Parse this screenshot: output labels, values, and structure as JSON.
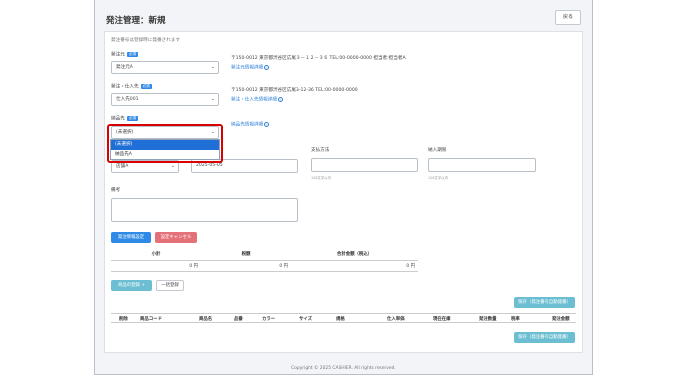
{
  "page": {
    "title": "発注管理：新規",
    "back_label": "戻る",
    "note": "発注番号は登録時に発番されます"
  },
  "order_source": {
    "label": "発注元",
    "required_badge": "必須",
    "value": "発注元A",
    "address": "〒150-0012  東京都渋谷区広尾３－１２－３６  TEL:00-0000-0000  担当者:担当者A",
    "detail_link": "発注元情報詳細"
  },
  "supplier": {
    "label": "発注・仕入先",
    "required_badge": "必須",
    "value": "仕入先001",
    "address": "〒150-0012  東京都渋谷区広尾3-12-36  TEL:00-0000-0000",
    "detail_link": "発注・仕入先情報詳細"
  },
  "delivery": {
    "label": "納品先",
    "required_badge": "必須",
    "value": "(未選択)",
    "detail_link": "納品先情報詳細",
    "options": [
      "(未選択)",
      "納品先A"
    ]
  },
  "row3": {
    "store_value": "店舗A",
    "date_value": "2025-05-05",
    "payment_label": "支払方法",
    "payment_hint": "128文字以内",
    "deadline_label": "納入期限",
    "deadline_hint": "128文字以内"
  },
  "remarks": {
    "label": "備考"
  },
  "buttons": {
    "set_info": "発注情報設定",
    "cancel_setting": "設定キャンセル"
  },
  "summary": {
    "headers": [
      "小計",
      "税額",
      "合計金額（税込）"
    ],
    "values": [
      "0 円",
      "0 円",
      "0 円"
    ]
  },
  "product_buttons": {
    "register": "商品の登録",
    "register_icon": "plus-icon",
    "bulk": "一括登録"
  },
  "save_label": "保存（発注番号自動発番）",
  "product_table": {
    "headers": [
      "削除",
      "商品コード",
      "商品名",
      "品番",
      "カラー",
      "サイズ",
      "規格",
      "仕入単価",
      "現在在庫",
      "発注数量",
      "税率",
      "発注金額"
    ]
  },
  "footer": "Copyright © 2025 CASHIER. All rights reserved.",
  "colors": {
    "accent": "#2e8ae6",
    "highlight": "#d90000",
    "cancel": "#e47078",
    "teal": "#6cbfd2"
  }
}
